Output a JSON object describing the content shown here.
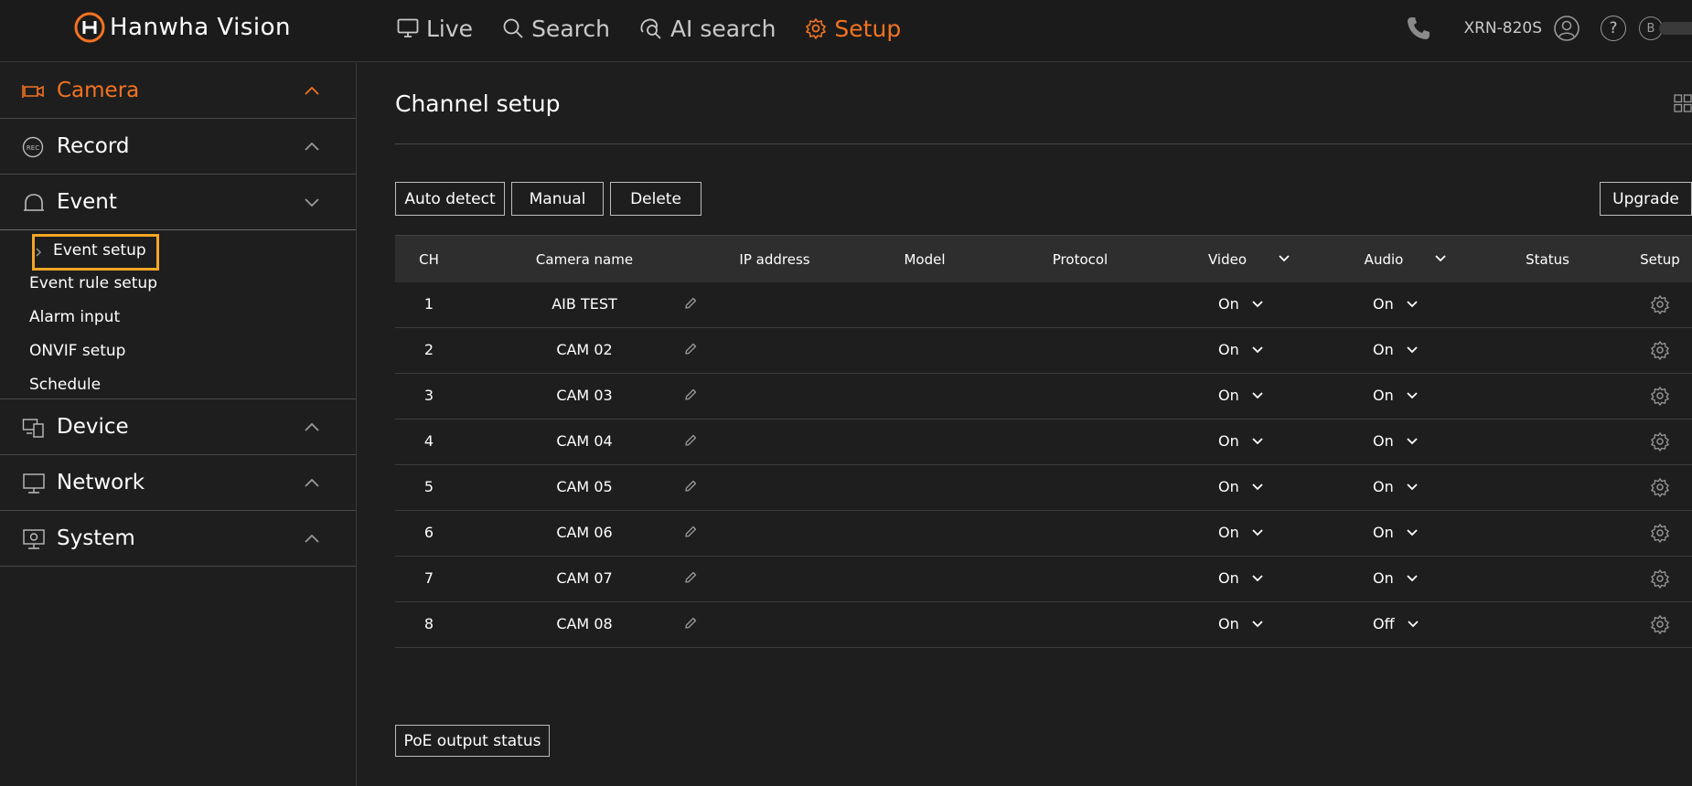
{
  "header": {
    "brand": "Hanwha Vision",
    "nav": [
      {
        "label": "Live",
        "icon": "monitor-icon"
      },
      {
        "label": "Search",
        "icon": "search-icon"
      },
      {
        "label": "AI search",
        "icon": "ai-search-icon"
      },
      {
        "label": "Setup",
        "icon": "gear-icon"
      }
    ],
    "active_nav": "Setup",
    "device_name": "XRN-820S",
    "help_label": "?",
    "user_badge": "B"
  },
  "sidebar": {
    "groups": [
      {
        "label": "Camera",
        "icon": "camera-icon",
        "active": true
      },
      {
        "label": "Record",
        "icon": "rec-icon"
      },
      {
        "label": "Event",
        "icon": "bell-icon",
        "expanded": true
      },
      {
        "label": "Device",
        "icon": "devices-icon"
      },
      {
        "label": "Network",
        "icon": "network-monitor-icon"
      },
      {
        "label": "System",
        "icon": "system-icon"
      }
    ],
    "event_items": [
      "Event setup",
      "Event rule setup",
      "Alarm input",
      "ONVIF setup",
      "Schedule"
    ],
    "selected_item": "Event setup"
  },
  "main": {
    "title": "Channel setup",
    "buttons": {
      "auto_detect": "Auto detect",
      "manual": "Manual",
      "delete": "Delete",
      "upgrade": "Upgrade",
      "poe": "PoE output status"
    },
    "columns": {
      "ch": "CH",
      "camera_name": "Camera name",
      "ip": "IP address",
      "model": "Model",
      "protocol": "Protocol",
      "video": "Video",
      "audio": "Audio",
      "status": "Status",
      "setup": "Setup"
    },
    "rows": [
      {
        "ch": "1",
        "name": "AIB TEST",
        "video": "On",
        "audio": "On"
      },
      {
        "ch": "2",
        "name": "CAM 02",
        "video": "On",
        "audio": "On"
      },
      {
        "ch": "3",
        "name": "CAM 03",
        "video": "On",
        "audio": "On"
      },
      {
        "ch": "4",
        "name": "CAM 04",
        "video": "On",
        "audio": "On"
      },
      {
        "ch": "5",
        "name": "CAM 05",
        "video": "On",
        "audio": "On"
      },
      {
        "ch": "6",
        "name": "CAM 06",
        "video": "On",
        "audio": "On"
      },
      {
        "ch": "7",
        "name": "CAM 07",
        "video": "On",
        "audio": "On"
      },
      {
        "ch": "8",
        "name": "CAM 08",
        "video": "On",
        "audio": "Off"
      }
    ]
  },
  "colors": {
    "accent": "#f37321",
    "highlight": "#f5a623",
    "background": "#1e1e1e",
    "table_header": "#2e2e2e"
  }
}
